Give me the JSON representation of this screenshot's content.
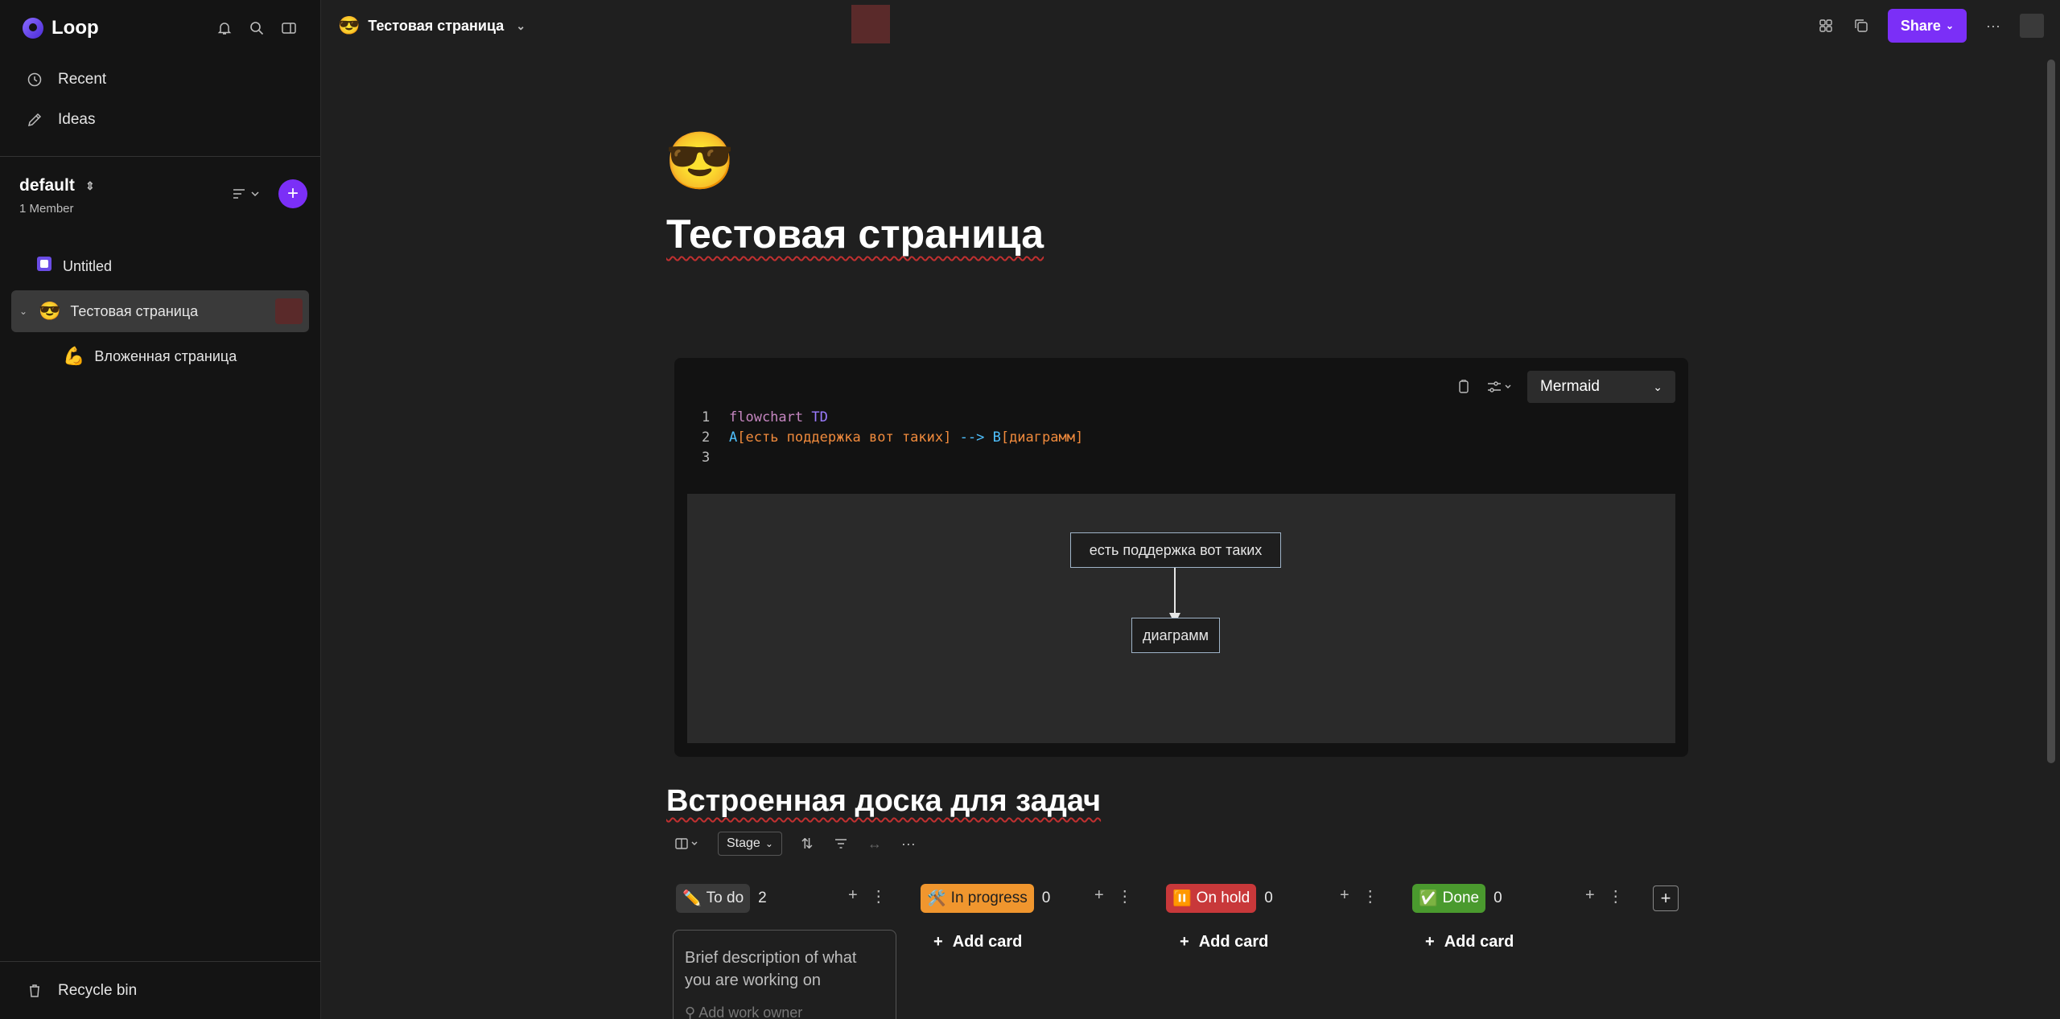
{
  "app": {
    "name": "Loop"
  },
  "sidebar": {
    "nav": [
      {
        "label": "Recent",
        "icon": "clock-icon"
      },
      {
        "label": "Ideas",
        "icon": "pen-icon"
      }
    ],
    "workspace": {
      "name": "default",
      "members": "1 Member"
    },
    "pages": [
      {
        "label": "Untitled",
        "icon": "page-icon"
      },
      {
        "label": "Тестовая страница",
        "icon": "😎"
      },
      {
        "label": "Вложенная страница",
        "icon": "💪"
      }
    ],
    "recycle_bin": "Recycle bin"
  },
  "topbar": {
    "breadcrumb": "Тестовая страница",
    "share_label": "Share"
  },
  "page": {
    "emoji": "😎",
    "title": "Тестовая страница"
  },
  "code_block": {
    "language": "Mermaid",
    "lines": [
      {
        "n": "1",
        "a": "flowchart",
        "b": "TD"
      },
      {
        "n": "2",
        "a": "A",
        "b": "[есть поддержка вот таких]",
        "c": "-->",
        "d": "B",
        "e": "[диаграмм]"
      },
      {
        "n": "3"
      }
    ],
    "diagram": {
      "node_a": "есть поддержка вот таких",
      "node_b": "диаграмм"
    }
  },
  "board": {
    "title": "Встроенная доска для задач",
    "group_by": "Stage",
    "columns": [
      {
        "emoji": "✏️",
        "label": "To do",
        "count": "2",
        "color": "#3a3a3a"
      },
      {
        "emoji": "🛠️",
        "label": "In progress",
        "count": "0",
        "color": "#f0962e"
      },
      {
        "emoji": "⏸️",
        "label": "On hold",
        "count": "0",
        "color": "#c8383a"
      },
      {
        "emoji": "✅",
        "label": "Done",
        "count": "0",
        "color": "#4a9a2e"
      }
    ],
    "add_card": "Add card",
    "card_placeholder": "Brief description of what you are working on",
    "card_owner_placeholder": "Add work owner"
  }
}
